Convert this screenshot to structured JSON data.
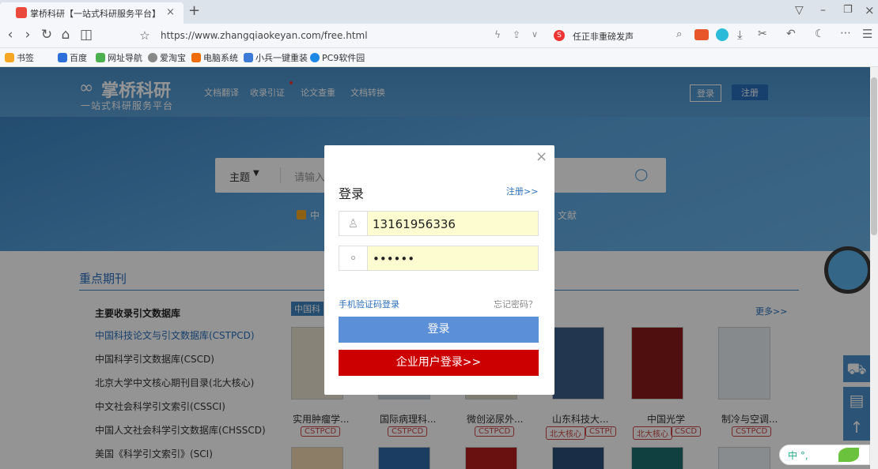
{
  "browser": {
    "tab_title": "掌桥科研【一站式科研服务平台】",
    "url": "https://www.zhangqiaokeyan.com/free.html",
    "news_text": "任正非重磅发声",
    "bookmarks": [
      "书签",
      "百度",
      "网址导航",
      "爱淘宝",
      "电脑系统",
      "小兵一键重装",
      "PC9软件园"
    ]
  },
  "site": {
    "logo_text": "掌桥科研",
    "logo_sub": "一站式科研服务平台",
    "nav": [
      "文档翻译",
      "收录引证",
      "论文查重",
      "文档转换"
    ],
    "login": "登录",
    "register": "注册",
    "search_type": "主题",
    "search_placeholder": "请输入",
    "check_left": "中",
    "check_right": "文献",
    "section_title": "重点期刊",
    "more": "更多>>",
    "db_header": "主要收录引文数据库",
    "db_list": [
      "中国科技论文与引文数据库(CSTPCD)",
      "中国科学引文数据库(CSCD)",
      "北京大学中文核心期刊目录(北大核心)",
      "中文社会科学引文索引(CSSCI)",
      "中国人文社会科学引文数据库(CHSSCD)",
      "美国《科学引文索引》(SCI)"
    ],
    "tab_label": "中国科",
    "journals": [
      {
        "name": "实用肿瘤学...",
        "tags": [
          "CSTPCD"
        ]
      },
      {
        "name": "国际病理科...",
        "tags": [
          "CSTPCD"
        ]
      },
      {
        "name": "微创泌尿外...",
        "tags": [
          "CSTPCD"
        ]
      },
      {
        "name": "山东科技大...",
        "tags": [
          "北大核心",
          "CSTP("
        ]
      },
      {
        "name": "中国光学",
        "tags": [
          "北大核心",
          "CSCD"
        ]
      },
      {
        "name": "制冷与空调...",
        "tags": [
          "CSTPCD"
        ]
      }
    ],
    "ime": "中 °, "
  },
  "modal": {
    "title": "登录",
    "register_link": "注册>>",
    "phone_value": "13161956336",
    "password_value": "••••••",
    "sms_login": "手机验证码登录",
    "forgot": "忘记密码？",
    "login_button": "登录",
    "enterprise_button": "企业用户登录>>"
  },
  "colors": {
    "blue": "#5b8fd8",
    "red": "#cc0000",
    "accent": "#3d84c0"
  }
}
